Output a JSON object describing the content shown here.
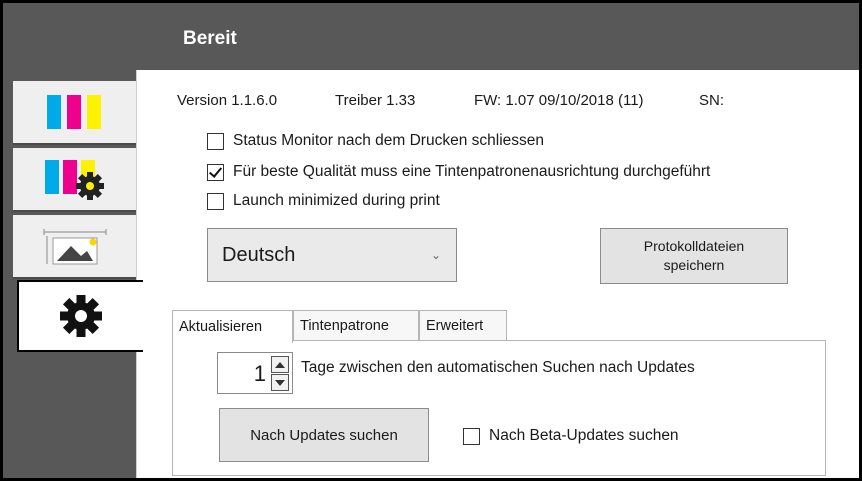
{
  "header": {
    "title": "Bereit"
  },
  "sidebar": {
    "tabs": [
      {
        "name": "ink-levels"
      },
      {
        "name": "ink-settings"
      },
      {
        "name": "print-layout"
      },
      {
        "name": "settings",
        "active": true
      }
    ],
    "colors": {
      "cyan": "#00a9e8",
      "magenta": "#ec008c",
      "yellow": "#fff200",
      "accent": "#ffd400"
    }
  },
  "info": {
    "version": "Version 1.1.6.0",
    "driver": "Treiber 1.33",
    "firmware": "FW: 1.07 09/10/2018 (11)",
    "serial_label": "SN:"
  },
  "options": [
    {
      "label": "Status Monitor nach dem Drucken schliessen",
      "checked": false
    },
    {
      "label": "Für beste Qualität muss eine Tintenpatronenausrichtung durchgeführt",
      "checked": true
    },
    {
      "label": "Launch minimized during print",
      "checked": false
    }
  ],
  "language": {
    "selected": "Deutsch",
    "chevron_icon": "chevron-down-icon"
  },
  "log_button": {
    "line1": "Protokolldateien",
    "line2": "speichern"
  },
  "tabs": [
    {
      "label": "Aktualisieren",
      "active": true
    },
    {
      "label": "Tintenpatrone",
      "active": false
    },
    {
      "label": "Erweitert",
      "active": false
    }
  ],
  "update_panel": {
    "days_value": "1",
    "days_label": "Tage zwischen den automatischen Suchen nach Updates",
    "check_button": "Nach Updates suchen",
    "beta_label": "Nach Beta-Updates suchen",
    "beta_checked": false
  }
}
